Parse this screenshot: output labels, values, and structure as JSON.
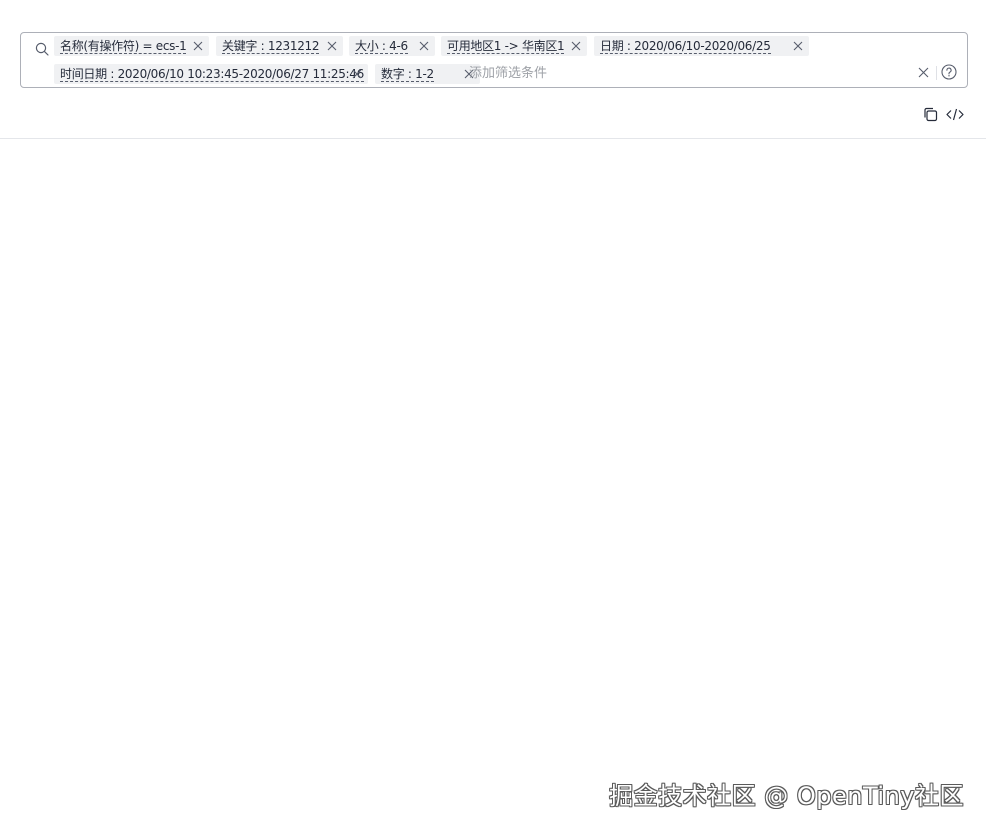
{
  "search": {
    "placeholder": "添加筛选条件",
    "tags": [
      {
        "label": "名称(有操作符) = ecs-1"
      },
      {
        "label": "关键字 : 1231212"
      },
      {
        "label": "大小 : 4-6"
      },
      {
        "label": "可用地区1 -> 华南区1"
      },
      {
        "label": "日期 : 2020/06/10-2020/06/25"
      },
      {
        "label": "时间日期 : 2020/06/10 10:23:45-2020/06/27 11:25:46"
      },
      {
        "label": "数字 : 1-2"
      }
    ]
  },
  "icons": {
    "search": "search-icon",
    "tag_close": "close-icon",
    "clear": "clear-icon",
    "help": "help-icon",
    "copy": "copy-icon",
    "code": "code-icon"
  },
  "watermark": {
    "text": "掘金技术社区 @ OpenTiny社区"
  },
  "colors": {
    "border": "#adb0b8",
    "tag_bg": "#f0f1f3",
    "text": "#252b3a",
    "placeholder": "#9ea1a7",
    "divider": "#e4e6ea"
  }
}
